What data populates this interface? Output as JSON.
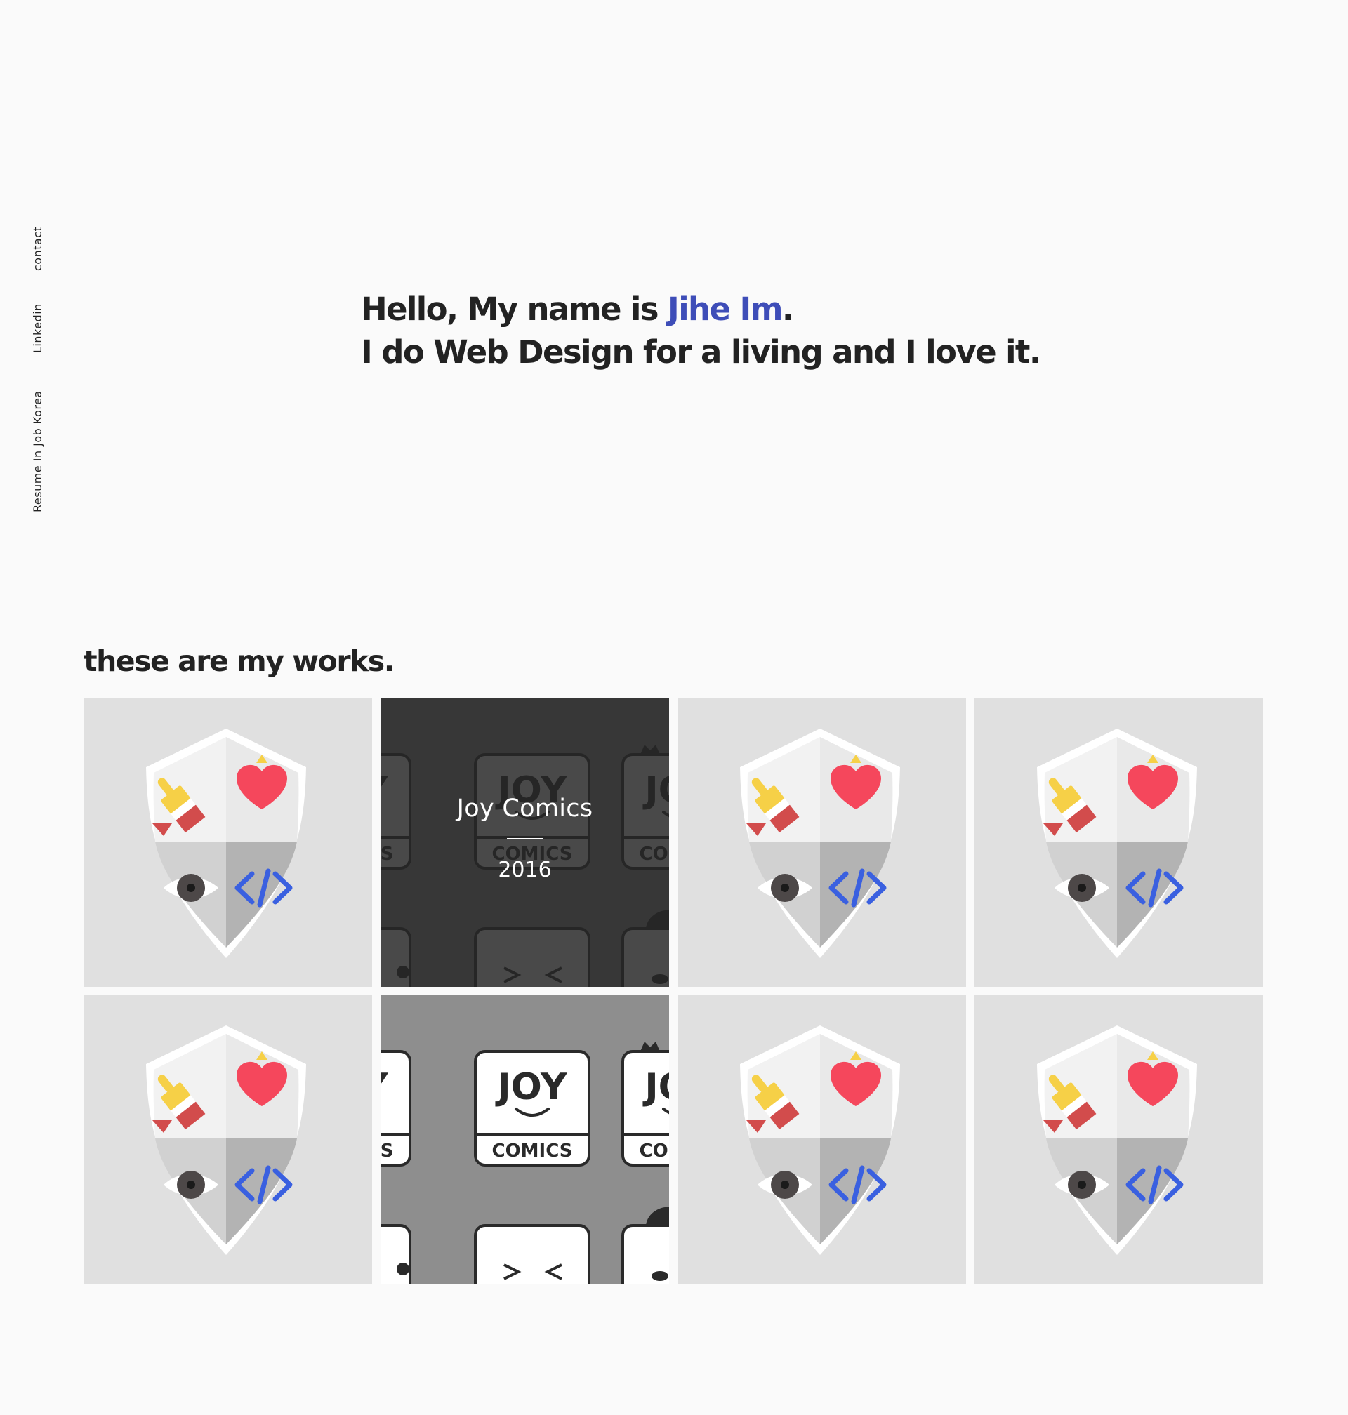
{
  "sidebar": {
    "links": [
      "contact",
      "Linkedin",
      "Resume In Job Korea"
    ]
  },
  "hero": {
    "greeting_prefix": "Hello, My name is ",
    "name": "Jihe Im",
    "greeting_suffix": ".",
    "tagline": "I do Web Design for a living and I love it."
  },
  "works": {
    "title": "these are my works.",
    "items": [
      {
        "kind": "badge-icon"
      },
      {
        "kind": "joy-comics-pattern",
        "title": "Joy Comics",
        "year": "2016",
        "hovered": true
      },
      {
        "kind": "badge-icon"
      },
      {
        "kind": "badge-icon"
      },
      {
        "kind": "badge-icon"
      },
      {
        "kind": "joy-comics-pattern"
      },
      {
        "kind": "badge-icon"
      },
      {
        "kind": "badge-icon"
      }
    ]
  },
  "joy_pattern_text": {
    "top": "JOY",
    "bottom": "COMICS"
  },
  "colors": {
    "accent": "#3e4db8",
    "text": "#222222",
    "background": "#fafafa",
    "tile_background": "#e0e0e0",
    "pattern_background": "#8e8e8e",
    "heart": "#f5475c",
    "brush": "#f6d047",
    "code": "#3a60e0"
  }
}
